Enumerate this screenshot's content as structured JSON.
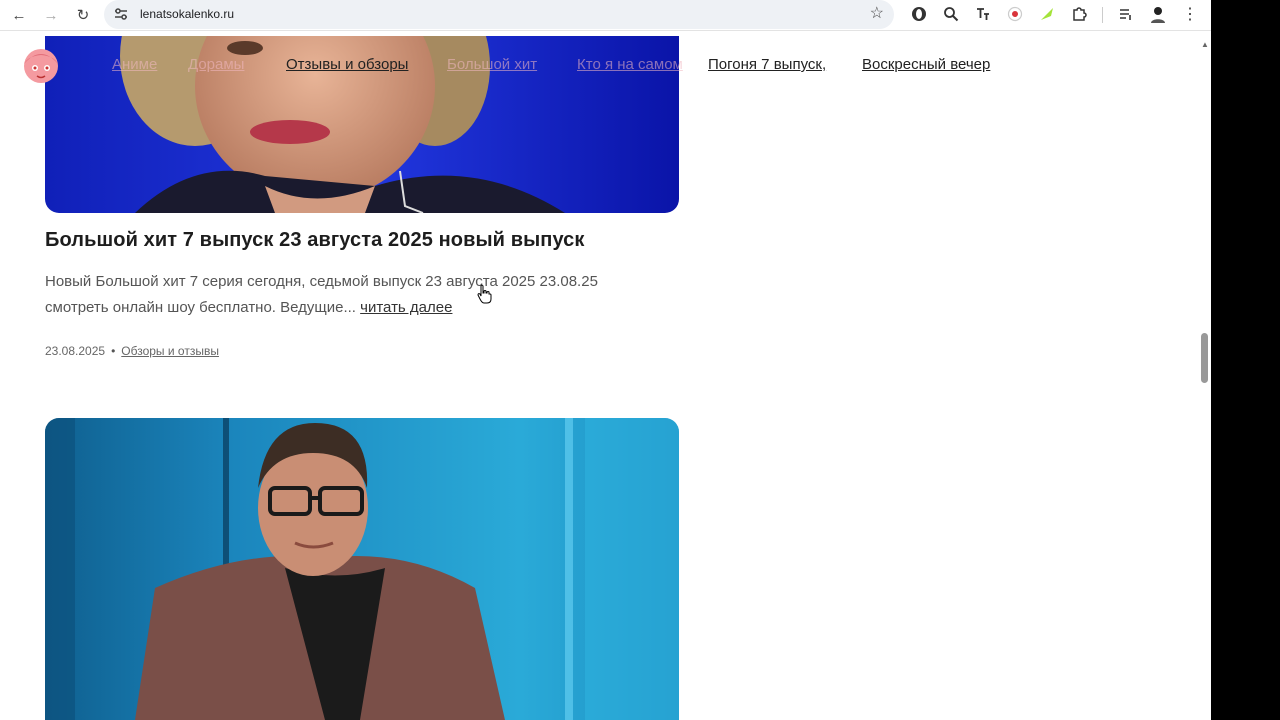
{
  "browser": {
    "url": "lenatsokalenko.ru",
    "extension_icons": [
      "opera-icon",
      "zoom-search-icon",
      "translate-icon",
      "record-icon",
      "leaf-icon",
      "puzzle-extensions-icon",
      "media-queue-icon",
      "profile-avatar-icon",
      "more-menu-icon"
    ]
  },
  "header": {
    "nav": [
      "Аниме",
      "Дорамы",
      "Отзывы и обзоры",
      "Большой хит",
      "Кто я на самом",
      "Погоня 7 выпуск,",
      "Воскресный вечер"
    ]
  },
  "post": {
    "title": "Большой хит 7 выпуск 23 августа 2025 новый выпуск",
    "excerpt": "Новый Большой хит 7 серия сегодня, седьмой выпуск 23 августа 2025 23.08.25 смотреть онлайн шоу бесплатно. Ведущие...",
    "read_more": "читать далее",
    "date": "23.08.2025",
    "separator": "•",
    "category": "Обзоры и отзывы"
  },
  "colors": {
    "img1_bg": "#1a1ed6",
    "img2_bg": "#1f9ccf"
  }
}
